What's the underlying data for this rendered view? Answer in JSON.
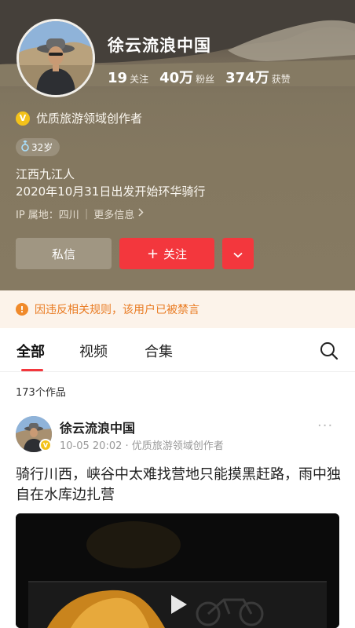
{
  "profile": {
    "name": "徐云流浪中国",
    "stats": [
      {
        "value": "19",
        "label": "关注"
      },
      {
        "value": "40万",
        "label": "粉丝"
      },
      {
        "value": "374万",
        "label": "获赞"
      }
    ],
    "verified_badge": "V",
    "verified_text": "优质旅游领域创作者",
    "age_tag": "32岁",
    "bio_line1": "江西九江人",
    "bio_line2": "2020年10月31日出发开始环华骑行",
    "ip_location": "IP 属地：四川",
    "more_info": "更多信息"
  },
  "actions": {
    "message_label": "私信",
    "follow_label": "关注",
    "follow_plus": "+"
  },
  "warning": {
    "text": "因违反相关规则，该用户已被禁言",
    "icon": "!"
  },
  "tabs": [
    {
      "label": "全部",
      "active": true
    },
    {
      "label": "视频",
      "active": false
    },
    {
      "label": "合集",
      "active": false
    }
  ],
  "works_count": "173个作品",
  "post": {
    "author": "徐云流浪中国",
    "badge": "V",
    "meta": "10-05 20:02 · 优质旅游领域创作者",
    "menu": "···",
    "text": "骑行川西，峡谷中太难找营地只能摸黑赶路，雨中独自在水库边扎营"
  },
  "colors": {
    "accent_red": "#f3373d",
    "warning_orange": "#e97b22",
    "verified_gold": "#f3c21a",
    "header_bg": "#867a62"
  },
  "icons": [
    "chevron-down-icon",
    "search-icon",
    "play-icon",
    "warning-icon",
    "chevron-right-icon"
  ]
}
